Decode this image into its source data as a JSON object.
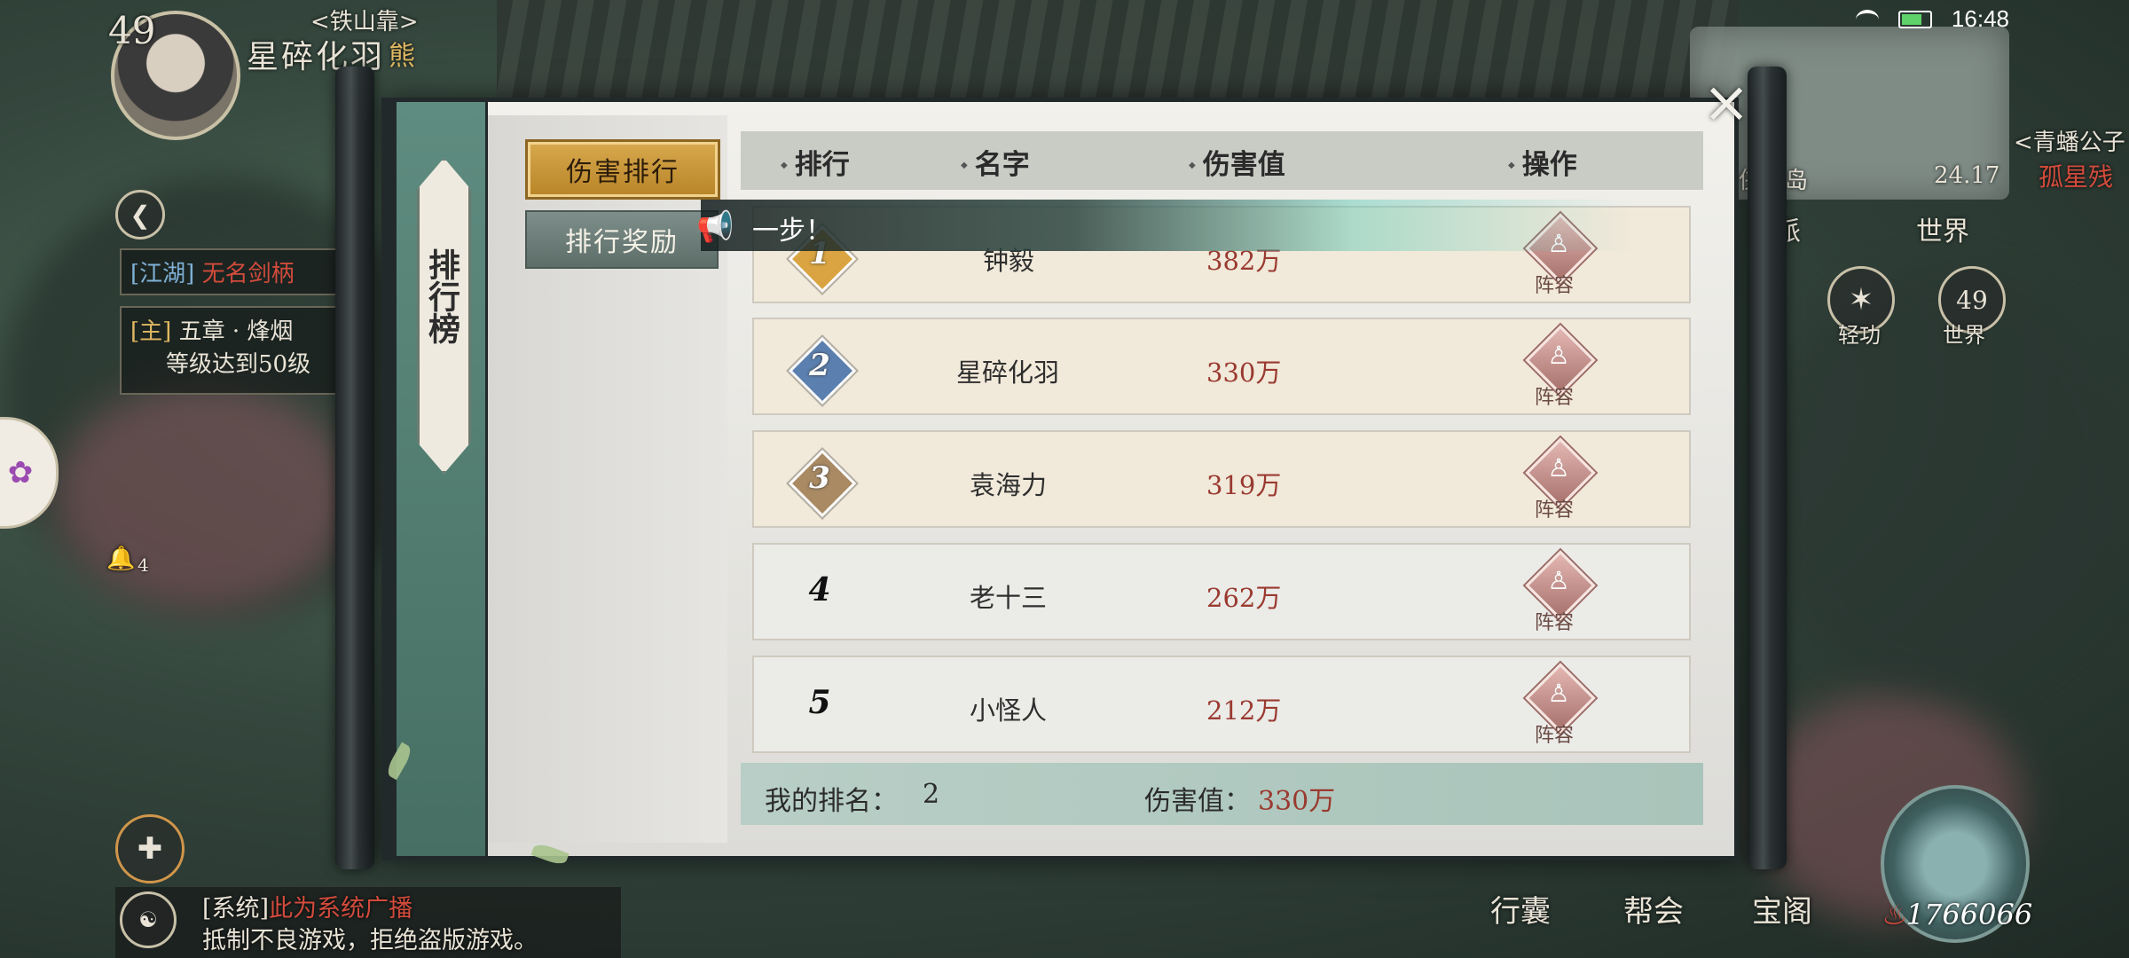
{
  "status": {
    "time": "16:48"
  },
  "player": {
    "level": "49",
    "name": "星碎化羽",
    "title": "<铁山靠>",
    "guild_char": "熊"
  },
  "hud": {
    "chat_channel_tag": "[江湖]",
    "chat_channel_name": "无名剑柄",
    "quest_tag": "[主]",
    "quest_title": "五章 · 烽烟",
    "quest_condition": "等级达到50级",
    "notify_count": "4",
    "map_name": "侠隐岛",
    "map_coord": "24.17",
    "npc_name": "<青蟠公子",
    "npc_sub": "孤星残",
    "btn_sect": "派",
    "btn_world": "世界",
    "skill_qinggong": "轻功",
    "skill_world": "世界",
    "skill_world_level": "49",
    "system_tag": "[系统]",
    "system_title": "此为系统广播",
    "system_message": "抵制不良游戏，拒绝盗版游戏。",
    "nav_xingnang": "行囊",
    "nav_banghui": "帮会",
    "nav_baoge": "宝阁",
    "power": "1766066"
  },
  "modal": {
    "side_title": "排行榜",
    "tabs": [
      {
        "label": "伤害排行",
        "active": true
      },
      {
        "label": "排行奖励",
        "active": false
      }
    ],
    "announcement": "一步！",
    "columns": [
      "排行",
      "名字",
      "伤害值",
      "操作"
    ],
    "rows": [
      {
        "rank": "1",
        "name": "钟毅",
        "damage": "382万",
        "action": "阵容"
      },
      {
        "rank": "2",
        "name": "星碎化羽",
        "damage": "330万",
        "action": "阵容"
      },
      {
        "rank": "3",
        "name": "袁海力",
        "damage": "319万",
        "action": "阵容"
      },
      {
        "rank": "4",
        "name": "老十三",
        "damage": "262万",
        "action": "阵容"
      },
      {
        "rank": "5",
        "name": "小怪人",
        "damage": "212万",
        "action": "阵容"
      }
    ],
    "footer": {
      "my_rank_label": "我的排名：",
      "my_rank_value": "2",
      "damage_label": "伤害值：",
      "damage_value": "330万"
    }
  },
  "colors": {
    "rank1": "#d9a441",
    "rank2": "#5b7fae",
    "rank3": "#a98a63",
    "tab_active": "#c9963a",
    "damage_text": "#9a3a30"
  },
  "icons": [
    "close-icon",
    "back-arrow-icon",
    "megaphone-icon",
    "lineup-person-icon",
    "bell-icon",
    "wifi-icon",
    "battery-icon"
  ]
}
